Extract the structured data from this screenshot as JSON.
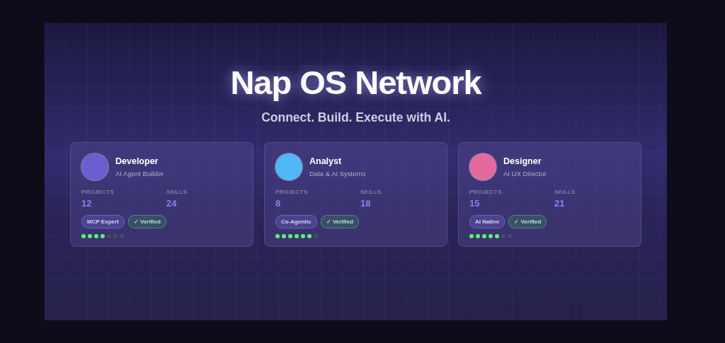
{
  "hero": {
    "title": "Nap OS Network",
    "subtitle": "Connect. Build. Execute with AI."
  },
  "profiles": [
    {
      "name": "Developer",
      "role": "AI Agent Builder",
      "color": "#6a5fd0",
      "stats": [
        {
          "label": "PROJECTS",
          "value": "12"
        },
        {
          "label": "SKILLS",
          "value": "24"
        }
      ],
      "tags": [
        {
          "kind": "skill",
          "text": "MCP Expert"
        },
        {
          "kind": "verified",
          "text": "✓ Verified"
        }
      ],
      "stars": 4
    },
    {
      "name": "Analyst",
      "role": "Data & AI Systems",
      "color": "#4fb8f5",
      "stats": [
        {
          "label": "PROJECTS",
          "value": "8"
        },
        {
          "label": "SKILLS",
          "value": "18"
        }
      ],
      "tags": [
        {
          "kind": "skill",
          "text": "Co-Agentic"
        },
        {
          "kind": "verified",
          "text": "✓ Verified"
        }
      ],
      "stars": 6
    },
    {
      "name": "Designer",
      "role": "AI UX Director",
      "color": "#e46a9e",
      "stats": [
        {
          "label": "PROJECTS",
          "value": "15"
        },
        {
          "label": "SKILLS",
          "value": "21"
        }
      ],
      "tags": [
        {
          "kind": "skill",
          "text": "AI Native"
        },
        {
          "kind": "verified",
          "text": "✓ Verified"
        }
      ],
      "stars": 5
    }
  ]
}
